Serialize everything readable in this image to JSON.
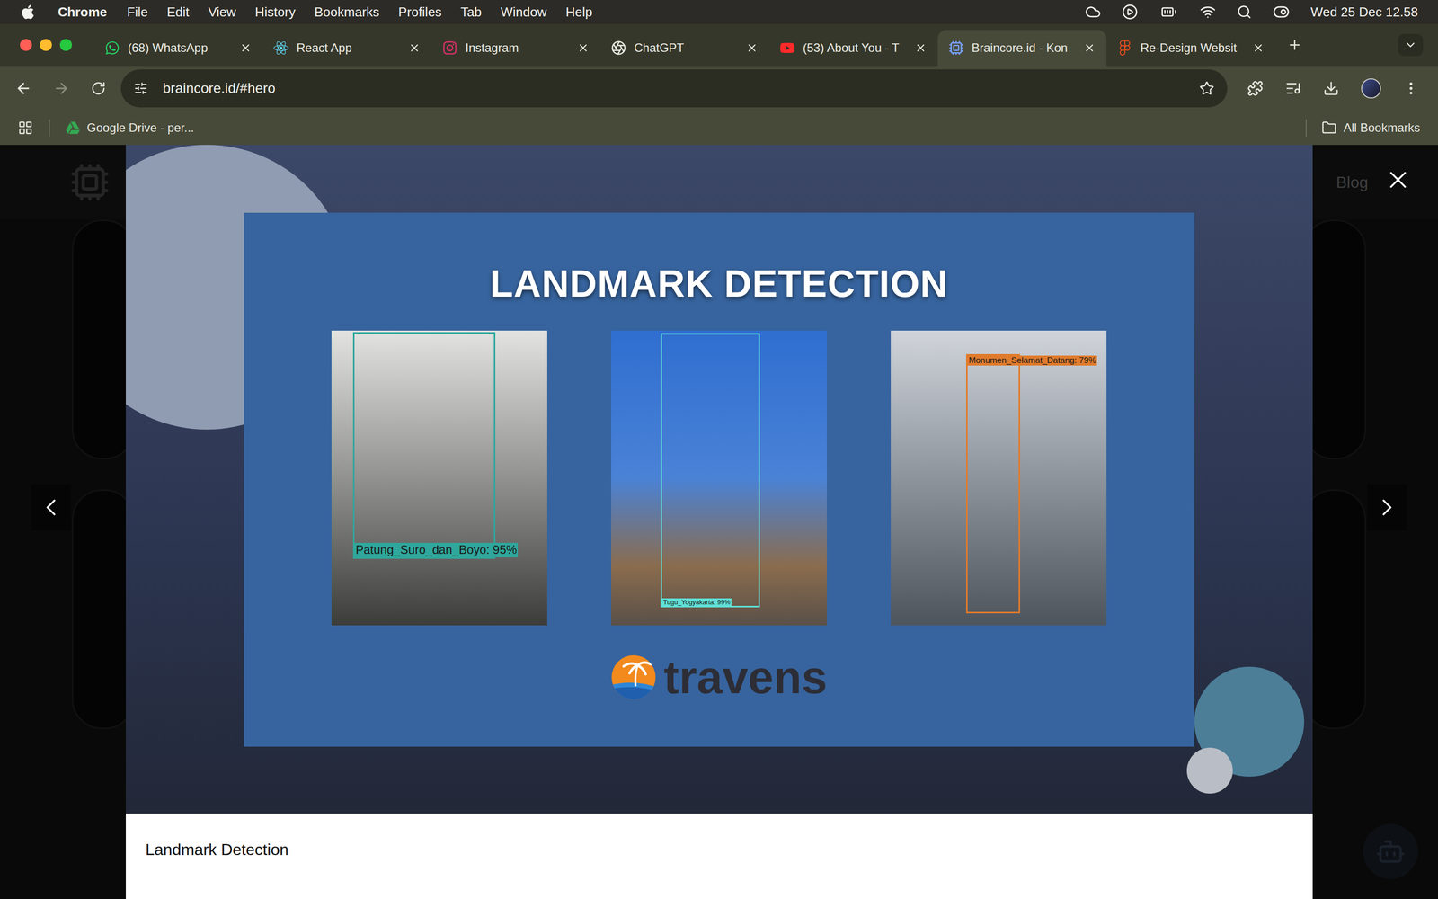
{
  "menu_bar": {
    "app": "Chrome",
    "items": [
      "File",
      "Edit",
      "View",
      "History",
      "Bookmarks",
      "Profiles",
      "Tab",
      "Window",
      "Help"
    ],
    "clock": "Wed 25 Dec 12.58"
  },
  "tabs": [
    {
      "title": "(68) WhatsApp",
      "selected": false
    },
    {
      "title": "React App",
      "selected": false
    },
    {
      "title": "Instagram",
      "selected": false
    },
    {
      "title": "ChatGPT",
      "selected": false
    },
    {
      "title": "(53) About You - T",
      "selected": false
    },
    {
      "title": "Braincore.id - Kon",
      "selected": true
    },
    {
      "title": "Re-Design Websit",
      "selected": false
    }
  ],
  "address_bar": {
    "url": "braincore.id/#hero"
  },
  "bookmarks": [
    {
      "label": "Google Drive - per..."
    }
  ],
  "all_bookmarks": "All Bookmarks",
  "page": {
    "nav_item": "Blog"
  },
  "lightbox": {
    "slide": {
      "heading": "LANDMARK DETECTION",
      "detections": [
        {
          "label": "Patung_Suro_dan_Boyo: 95%",
          "color": "#2fa79c"
        },
        {
          "label": "Tugu_Yogyakarta: 99%",
          "color": "#5fe0d6"
        },
        {
          "label": "Monumen_Selamat_Datang: 79%",
          "color": "#e07b2c"
        }
      ],
      "brand": "travens"
    },
    "caption": "Landmark Detection"
  }
}
